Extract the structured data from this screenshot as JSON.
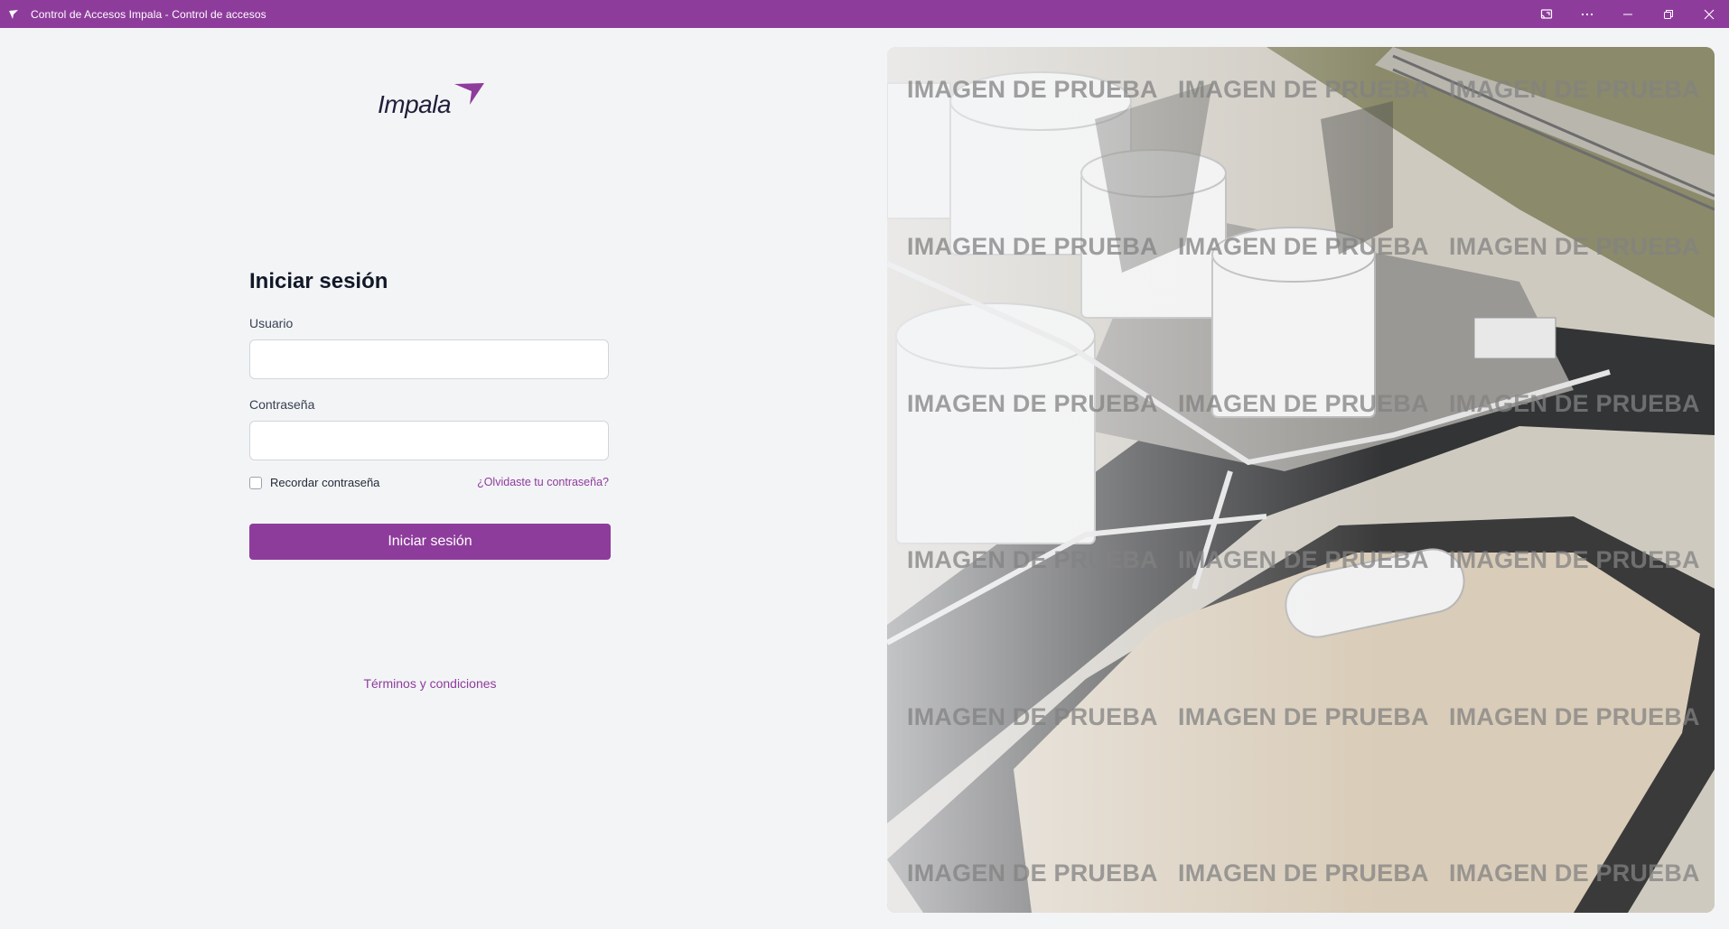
{
  "window": {
    "title": "Control de Accesos Impala - Control de accesos",
    "accent_color": "#8e3c9c",
    "controls": [
      "cast-icon",
      "more-icon",
      "minimize-icon",
      "restore-icon",
      "close-icon"
    ]
  },
  "logo": {
    "text": "Impala"
  },
  "login": {
    "title": "Iniciar sesión",
    "user_label": "Usuario",
    "user_value": "",
    "password_label": "Contraseña",
    "password_value": "",
    "remember_label": "Recordar contraseña",
    "remember_checked": false,
    "forgot_link": "¿Olvidaste tu contraseña?",
    "submit_label": "Iniciar sesión",
    "terms_link": "Términos y condiciones"
  },
  "image_panel": {
    "watermark_text": "IMAGEN DE PRUEBA"
  }
}
